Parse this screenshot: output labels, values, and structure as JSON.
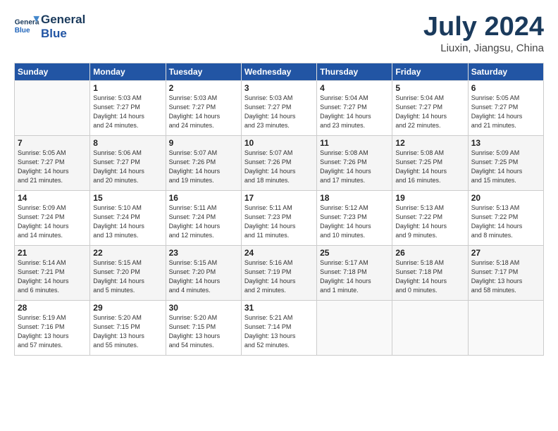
{
  "header": {
    "logo_line1": "General",
    "logo_line2": "Blue",
    "month": "July 2024",
    "location": "Liuxin, Jiangsu, China"
  },
  "days_of_week": [
    "Sunday",
    "Monday",
    "Tuesday",
    "Wednesday",
    "Thursday",
    "Friday",
    "Saturday"
  ],
  "weeks": [
    [
      {
        "day": "",
        "info": ""
      },
      {
        "day": "1",
        "info": "Sunrise: 5:03 AM\nSunset: 7:27 PM\nDaylight: 14 hours\nand 24 minutes."
      },
      {
        "day": "2",
        "info": "Sunrise: 5:03 AM\nSunset: 7:27 PM\nDaylight: 14 hours\nand 24 minutes."
      },
      {
        "day": "3",
        "info": "Sunrise: 5:03 AM\nSunset: 7:27 PM\nDaylight: 14 hours\nand 23 minutes."
      },
      {
        "day": "4",
        "info": "Sunrise: 5:04 AM\nSunset: 7:27 PM\nDaylight: 14 hours\nand 23 minutes."
      },
      {
        "day": "5",
        "info": "Sunrise: 5:04 AM\nSunset: 7:27 PM\nDaylight: 14 hours\nand 22 minutes."
      },
      {
        "day": "6",
        "info": "Sunrise: 5:05 AM\nSunset: 7:27 PM\nDaylight: 14 hours\nand 21 minutes."
      }
    ],
    [
      {
        "day": "7",
        "info": "Sunrise: 5:05 AM\nSunset: 7:27 PM\nDaylight: 14 hours\nand 21 minutes."
      },
      {
        "day": "8",
        "info": "Sunrise: 5:06 AM\nSunset: 7:27 PM\nDaylight: 14 hours\nand 20 minutes."
      },
      {
        "day": "9",
        "info": "Sunrise: 5:07 AM\nSunset: 7:26 PM\nDaylight: 14 hours\nand 19 minutes."
      },
      {
        "day": "10",
        "info": "Sunrise: 5:07 AM\nSunset: 7:26 PM\nDaylight: 14 hours\nand 18 minutes."
      },
      {
        "day": "11",
        "info": "Sunrise: 5:08 AM\nSunset: 7:26 PM\nDaylight: 14 hours\nand 17 minutes."
      },
      {
        "day": "12",
        "info": "Sunrise: 5:08 AM\nSunset: 7:25 PM\nDaylight: 14 hours\nand 16 minutes."
      },
      {
        "day": "13",
        "info": "Sunrise: 5:09 AM\nSunset: 7:25 PM\nDaylight: 14 hours\nand 15 minutes."
      }
    ],
    [
      {
        "day": "14",
        "info": "Sunrise: 5:09 AM\nSunset: 7:24 PM\nDaylight: 14 hours\nand 14 minutes."
      },
      {
        "day": "15",
        "info": "Sunrise: 5:10 AM\nSunset: 7:24 PM\nDaylight: 14 hours\nand 13 minutes."
      },
      {
        "day": "16",
        "info": "Sunrise: 5:11 AM\nSunset: 7:24 PM\nDaylight: 14 hours\nand 12 minutes."
      },
      {
        "day": "17",
        "info": "Sunrise: 5:11 AM\nSunset: 7:23 PM\nDaylight: 14 hours\nand 11 minutes."
      },
      {
        "day": "18",
        "info": "Sunrise: 5:12 AM\nSunset: 7:23 PM\nDaylight: 14 hours\nand 10 minutes."
      },
      {
        "day": "19",
        "info": "Sunrise: 5:13 AM\nSunset: 7:22 PM\nDaylight: 14 hours\nand 9 minutes."
      },
      {
        "day": "20",
        "info": "Sunrise: 5:13 AM\nSunset: 7:22 PM\nDaylight: 14 hours\nand 8 minutes."
      }
    ],
    [
      {
        "day": "21",
        "info": "Sunrise: 5:14 AM\nSunset: 7:21 PM\nDaylight: 14 hours\nand 6 minutes."
      },
      {
        "day": "22",
        "info": "Sunrise: 5:15 AM\nSunset: 7:20 PM\nDaylight: 14 hours\nand 5 minutes."
      },
      {
        "day": "23",
        "info": "Sunrise: 5:15 AM\nSunset: 7:20 PM\nDaylight: 14 hours\nand 4 minutes."
      },
      {
        "day": "24",
        "info": "Sunrise: 5:16 AM\nSunset: 7:19 PM\nDaylight: 14 hours\nand 2 minutes."
      },
      {
        "day": "25",
        "info": "Sunrise: 5:17 AM\nSunset: 7:18 PM\nDaylight: 14 hours\nand 1 minute."
      },
      {
        "day": "26",
        "info": "Sunrise: 5:18 AM\nSunset: 7:18 PM\nDaylight: 14 hours\nand 0 minutes."
      },
      {
        "day": "27",
        "info": "Sunrise: 5:18 AM\nSunset: 7:17 PM\nDaylight: 13 hours\nand 58 minutes."
      }
    ],
    [
      {
        "day": "28",
        "info": "Sunrise: 5:19 AM\nSunset: 7:16 PM\nDaylight: 13 hours\nand 57 minutes."
      },
      {
        "day": "29",
        "info": "Sunrise: 5:20 AM\nSunset: 7:15 PM\nDaylight: 13 hours\nand 55 minutes."
      },
      {
        "day": "30",
        "info": "Sunrise: 5:20 AM\nSunset: 7:15 PM\nDaylight: 13 hours\nand 54 minutes."
      },
      {
        "day": "31",
        "info": "Sunrise: 5:21 AM\nSunset: 7:14 PM\nDaylight: 13 hours\nand 52 minutes."
      },
      {
        "day": "",
        "info": ""
      },
      {
        "day": "",
        "info": ""
      },
      {
        "day": "",
        "info": ""
      }
    ]
  ]
}
